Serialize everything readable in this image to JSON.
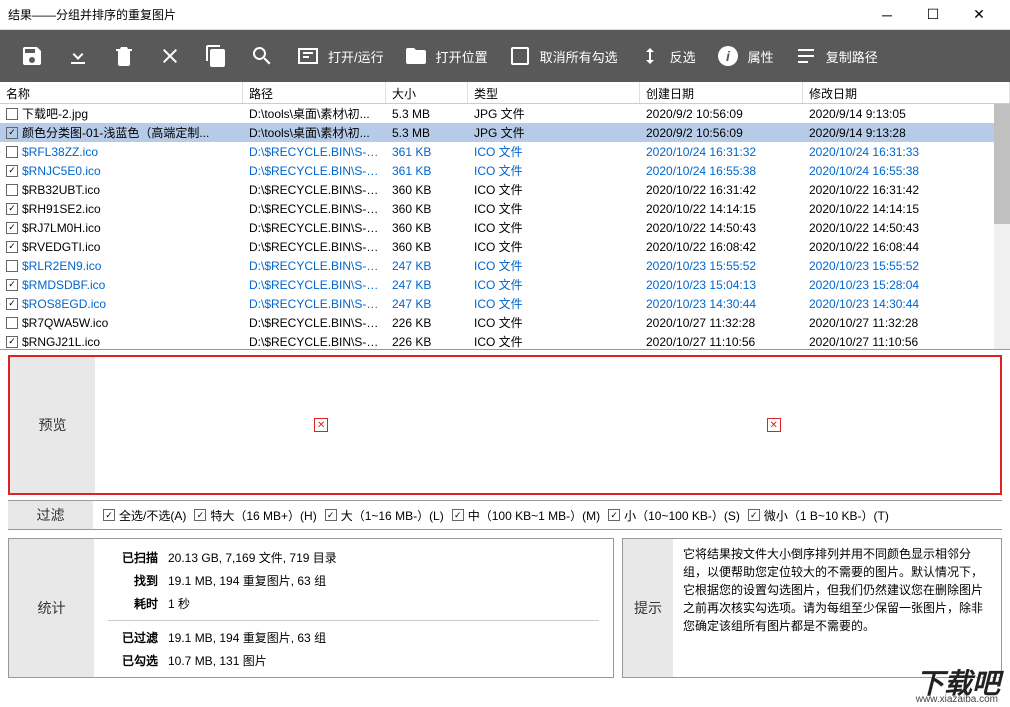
{
  "window": {
    "title": "结果——分组并排序的重复图片"
  },
  "toolbar": {
    "items": [
      {
        "icon": "save",
        "label": ""
      },
      {
        "icon": "download",
        "label": ""
      },
      {
        "icon": "trash",
        "label": ""
      },
      {
        "icon": "close",
        "label": ""
      },
      {
        "icon": "copy",
        "label": ""
      },
      {
        "icon": "search",
        "label": ""
      },
      {
        "icon": "open",
        "label": "打开/运行"
      },
      {
        "icon": "folder",
        "label": "打开位置"
      },
      {
        "icon": "uncheck",
        "label": "取消所有勾选"
      },
      {
        "icon": "invert",
        "label": "反选"
      },
      {
        "icon": "info",
        "label": "属性"
      },
      {
        "icon": "path",
        "label": "复制路径"
      }
    ]
  },
  "columns": {
    "name": "名称",
    "path": "路径",
    "size": "大小",
    "type": "类型",
    "created": "创建日期",
    "modified": "修改日期"
  },
  "rows": [
    {
      "checked": false,
      "blue": false,
      "selected": false,
      "name": "下载吧-2.jpg",
      "path": "D:\\tools\\桌面\\素材\\初...",
      "size": "5.3 MB",
      "type": "JPG 文件",
      "created": "2020/9/2 10:56:09",
      "modified": "2020/9/14 9:13:05"
    },
    {
      "checked": true,
      "blue": false,
      "selected": true,
      "name": "颜色分类图-01-浅蓝色（高端定制...",
      "path": "D:\\tools\\桌面\\素材\\初...",
      "size": "5.3 MB",
      "type": "JPG 文件",
      "created": "2020/9/2 10:56:09",
      "modified": "2020/9/14 9:13:28"
    },
    {
      "checked": false,
      "blue": true,
      "selected": false,
      "name": "$RFL38ZZ.ico",
      "path": "D:\\$RECYCLE.BIN\\S-1-...",
      "size": "361 KB",
      "type": "ICO 文件",
      "created": "2020/10/24 16:31:32",
      "modified": "2020/10/24 16:31:33"
    },
    {
      "checked": true,
      "blue": true,
      "selected": false,
      "name": "$RNJC5E0.ico",
      "path": "D:\\$RECYCLE.BIN\\S-1-...",
      "size": "361 KB",
      "type": "ICO 文件",
      "created": "2020/10/24 16:55:38",
      "modified": "2020/10/24 16:55:38"
    },
    {
      "checked": false,
      "blue": false,
      "selected": false,
      "name": "$RB32UBT.ico",
      "path": "D:\\$RECYCLE.BIN\\S-1-...",
      "size": "360 KB",
      "type": "ICO 文件",
      "created": "2020/10/22 16:31:42",
      "modified": "2020/10/22 16:31:42"
    },
    {
      "checked": true,
      "blue": false,
      "selected": false,
      "name": "$RH91SE2.ico",
      "path": "D:\\$RECYCLE.BIN\\S-1-...",
      "size": "360 KB",
      "type": "ICO 文件",
      "created": "2020/10/22 14:14:15",
      "modified": "2020/10/22 14:14:15"
    },
    {
      "checked": true,
      "blue": false,
      "selected": false,
      "name": "$RJ7LM0H.ico",
      "path": "D:\\$RECYCLE.BIN\\S-1-...",
      "size": "360 KB",
      "type": "ICO 文件",
      "created": "2020/10/22 14:50:43",
      "modified": "2020/10/22 14:50:43"
    },
    {
      "checked": true,
      "blue": false,
      "selected": false,
      "name": "$RVEDGTI.ico",
      "path": "D:\\$RECYCLE.BIN\\S-1-...",
      "size": "360 KB",
      "type": "ICO 文件",
      "created": "2020/10/22 16:08:42",
      "modified": "2020/10/22 16:08:44"
    },
    {
      "checked": false,
      "blue": true,
      "selected": false,
      "name": "$RLR2EN9.ico",
      "path": "D:\\$RECYCLE.BIN\\S-1-...",
      "size": "247 KB",
      "type": "ICO 文件",
      "created": "2020/10/23 15:55:52",
      "modified": "2020/10/23 15:55:52"
    },
    {
      "checked": true,
      "blue": true,
      "selected": false,
      "name": "$RMDSDBF.ico",
      "path": "D:\\$RECYCLE.BIN\\S-1-...",
      "size": "247 KB",
      "type": "ICO 文件",
      "created": "2020/10/23 15:04:13",
      "modified": "2020/10/23 15:28:04"
    },
    {
      "checked": true,
      "blue": true,
      "selected": false,
      "name": "$ROS8EGD.ico",
      "path": "D:\\$RECYCLE.BIN\\S-1-...",
      "size": "247 KB",
      "type": "ICO 文件",
      "created": "2020/10/23 14:30:44",
      "modified": "2020/10/23 14:30:44"
    },
    {
      "checked": false,
      "blue": false,
      "selected": false,
      "name": "$R7QWA5W.ico",
      "path": "D:\\$RECYCLE.BIN\\S-1-...",
      "size": "226 KB",
      "type": "ICO 文件",
      "created": "2020/10/27 11:32:28",
      "modified": "2020/10/27 11:32:28"
    },
    {
      "checked": true,
      "blue": false,
      "selected": false,
      "name": "$RNGJ21L.ico",
      "path": "D:\\$RECYCLE.BIN\\S-1-...",
      "size": "226 KB",
      "type": "ICO 文件",
      "created": "2020/10/27 11:10:56",
      "modified": "2020/10/27 11:10:56"
    }
  ],
  "preview": {
    "label": "预览"
  },
  "filter": {
    "label": "过滤",
    "items": [
      {
        "checked": true,
        "text": "全选/不选(A)"
      },
      {
        "checked": true,
        "text": "特大（16 MB+）(H)"
      },
      {
        "checked": true,
        "text": "大（1~16 MB-）(L)"
      },
      {
        "checked": true,
        "text": "中（100 KB~1 MB-）(M)"
      },
      {
        "checked": true,
        "text": "小（10~100 KB-）(S)"
      },
      {
        "checked": true,
        "text": "微小（1 B~10 KB-）(T)"
      }
    ]
  },
  "stats": {
    "label": "统计",
    "scanned_key": "已扫描",
    "scanned_val": "20.13 GB, 7,169 文件, 719 目录",
    "found_key": "找到",
    "found_val": "19.1 MB, 194 重复图片, 63 组",
    "time_key": "耗时",
    "time_val": "1 秒",
    "filtered_key": "已过滤",
    "filtered_val": "19.1 MB, 194 重复图片, 63 组",
    "checked_key": "已勾选",
    "checked_val": "10.7 MB, 131 图片"
  },
  "hint": {
    "label": "提示",
    "text": "它将结果按文件大小倒序排列并用不同颜色显示相邻分组，以便帮助您定位较大的不需要的图片。默认情况下，它根据您的设置勾选图片，但我们仍然建议您在删除图片之前再次核实勾选项。请为每组至少保留一张图片，除非您确定该组所有图片都是不需要的。"
  },
  "watermark": {
    "main": "下载吧",
    "sub": "www.xiazaiba.com"
  }
}
